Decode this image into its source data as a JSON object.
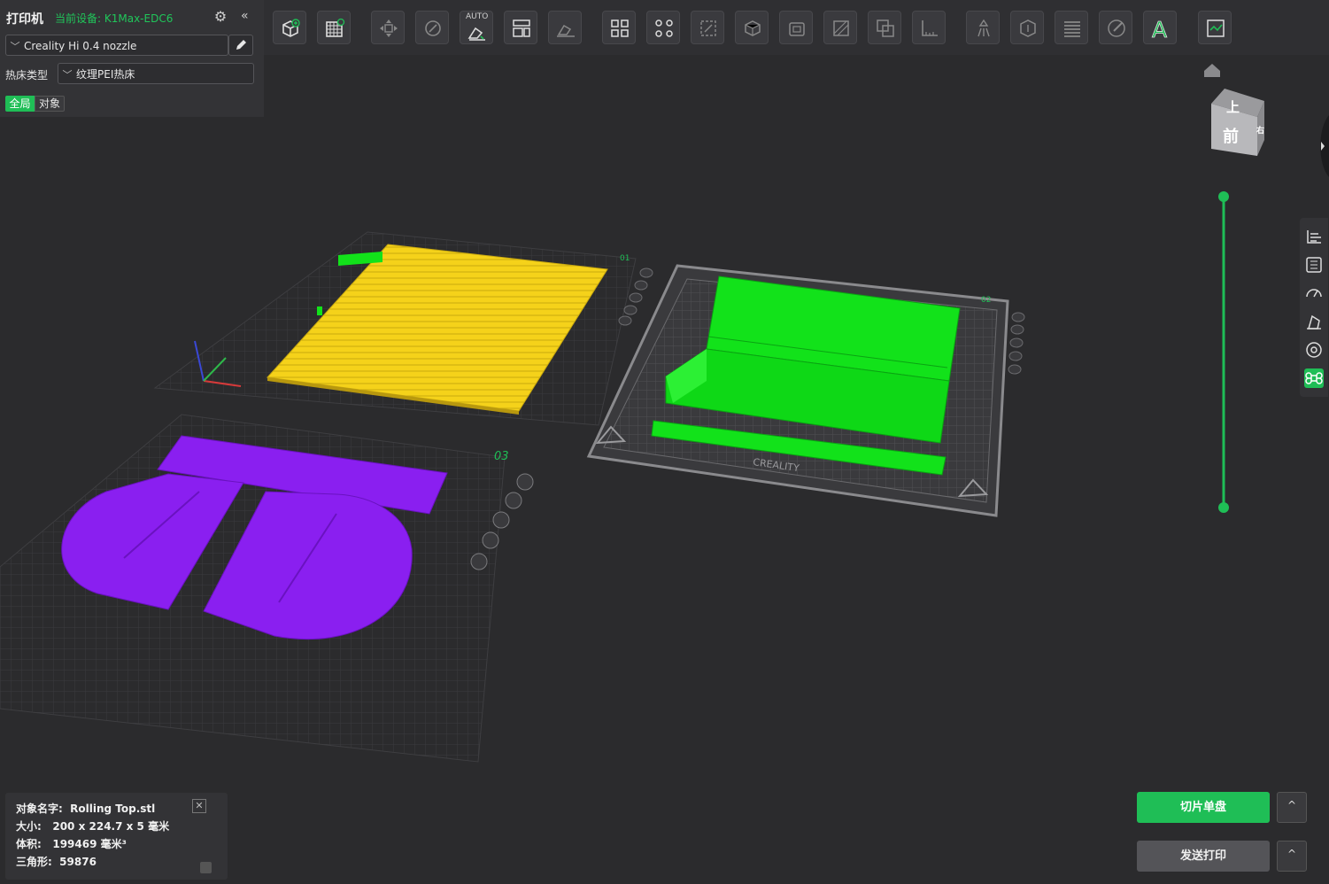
{
  "printer_panel": {
    "title": "打印机",
    "current_device": "当前设备: K1Max-EDC6",
    "nozzle": "Creality Hi 0.4 nozzle",
    "bed_type_label": "热床类型",
    "bed_type_value": "纹理PEI热床",
    "tab_global": "全局",
    "tab_object": "对象"
  },
  "toolbar": {
    "auto_label": "AUTO",
    "icons": [
      "add-object-icon",
      "plate-grid-icon",
      "move-icon",
      "rotate-icon",
      "auto-orient-icon",
      "arrange-icon",
      "lay-on-face-icon",
      "split-objects-icon",
      "split-parts-icon",
      "scale-icon",
      "hollow-icon",
      "shell-icon",
      "cut-icon",
      "boolean-icon",
      "measure-icon",
      "support-paint-icon",
      "seam-paint-icon",
      "layers-icon",
      "color-paint-icon",
      "text-icon",
      "assembly-view-icon"
    ],
    "text_icon_glyph": "A"
  },
  "plates": {
    "plate1": "01",
    "plate2": "02",
    "plate3": "03",
    "bed_brand": "CREALITY"
  },
  "nav_cube": {
    "top": "上",
    "front": "前",
    "right": "右"
  },
  "object_info": {
    "name_label": "对象名字:",
    "name_value": "Rolling Top.stl",
    "size_label": "大小:",
    "size_value": "200 x 224.7 x 5 毫米",
    "volume_label": "体积:",
    "volume_value": "199469 毫米³",
    "triangles_label": "三角形:",
    "triangles_value": "59876"
  },
  "actions": {
    "slice_label": "切片单盘",
    "send_label": "发送打印",
    "caret": "^"
  },
  "colors": {
    "accent": "#1fbe56",
    "yellow_object": "#f5d21a",
    "green_object": "#12e21a",
    "purple_object": "#8a1ff0"
  }
}
